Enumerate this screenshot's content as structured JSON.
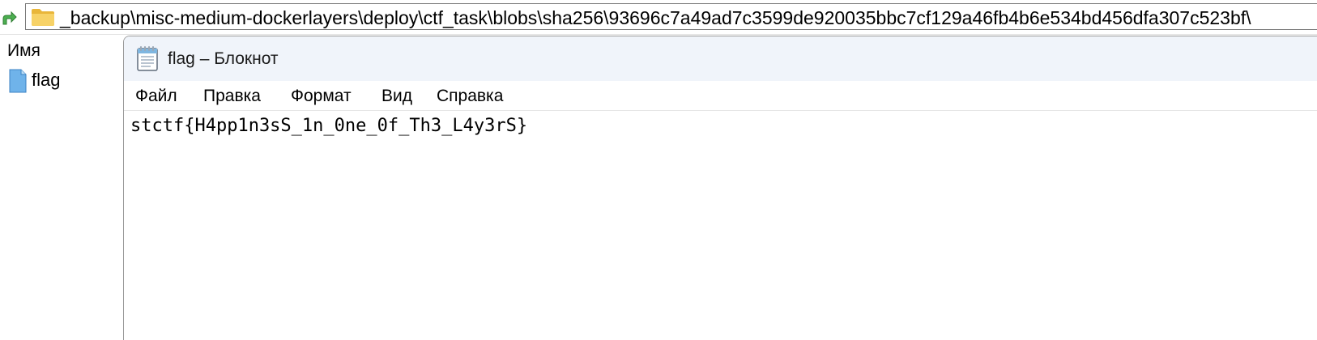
{
  "explorer": {
    "address_path": "_backup\\misc-medium-dockerlayers\\deploy\\ctf_task\\blobs\\sha256\\93696c7a49ad7c3599de920035bbc7cf129a46fb4b6e534bd456dfa307c523bf\\",
    "column_header": "Имя",
    "files": [
      {
        "name": "flag",
        "icon": "text-file-icon"
      }
    ]
  },
  "notepad": {
    "title": "flag – Блокнот",
    "menu": {
      "file": "Файл",
      "edit": "Правка",
      "format": "Формат",
      "view": "Вид",
      "help": "Справка"
    },
    "content": "stctf{H4pp1n3sS_1n_0ne_0f_Th3_L4y3rS}"
  },
  "colors": {
    "titlebar_bg": "#f0f4fa",
    "folder_yellow": "#f7c948",
    "file_blue": "#5aa8e6"
  }
}
